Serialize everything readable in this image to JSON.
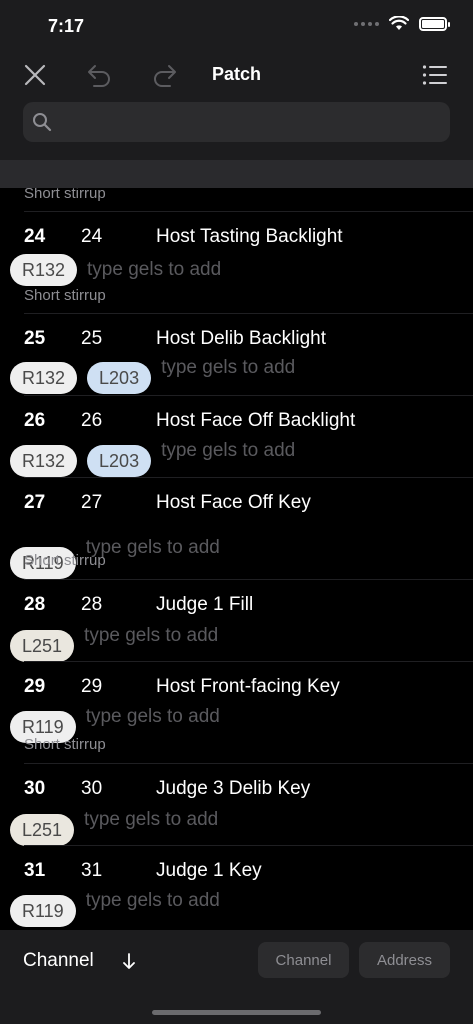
{
  "status": {
    "time": "7:17"
  },
  "nav": {
    "title": "Patch"
  },
  "search": {
    "placeholder": ""
  },
  "rows": [
    {
      "note": "Short stirrup",
      "channel": "24",
      "address": "24",
      "name": "Host Tasting Backlight",
      "gels": [
        {
          "label": "R132",
          "kind": "r"
        }
      ],
      "placeholder": "type gels to add"
    },
    {
      "note": "Short stirrup",
      "channel": "25",
      "address": "25",
      "name": "Host Delib Backlight",
      "gels": [
        {
          "label": "R132",
          "kind": "r"
        },
        {
          "label": "L203",
          "kind": "l"
        }
      ],
      "placeholder": "type gels to add"
    },
    {
      "note": "",
      "channel": "26",
      "address": "26",
      "name": "Host Face Off Backlight",
      "gels": [
        {
          "label": "R132",
          "kind": "r"
        },
        {
          "label": "L203",
          "kind": "l"
        }
      ],
      "placeholder": "type gels to add"
    },
    {
      "note": "",
      "channel": "27",
      "address": "27",
      "name": "Host Face Off Key",
      "gels": [
        {
          "label": "R119",
          "kind": "r"
        }
      ],
      "placeholder": "type gels to add"
    },
    {
      "note": "Short stirrup",
      "channel": "28",
      "address": "28",
      "name": "Judge 1 Fill",
      "gels": [
        {
          "label": "L251",
          "kind": "w"
        }
      ],
      "placeholder": "type gels to add"
    },
    {
      "note": "",
      "channel": "29",
      "address": "29",
      "name": "Host Front-facing Key",
      "gels": [
        {
          "label": "R119",
          "kind": "r"
        }
      ],
      "placeholder": "type gels to add"
    },
    {
      "note": "Short stirrup",
      "channel": "30",
      "address": "30",
      "name": "Judge 3 Delib Key",
      "gels": [
        {
          "label": "L251",
          "kind": "w"
        }
      ],
      "placeholder": "type gels to add"
    },
    {
      "note": "",
      "channel": "31",
      "address": "31",
      "name": "Judge 1 Key",
      "gels": [
        {
          "label": "R119",
          "kind": "r"
        }
      ],
      "placeholder": "type gels to add"
    }
  ],
  "bottom": {
    "sort_label": "Channel",
    "seg_channel": "Channel",
    "seg_address": "Address"
  }
}
